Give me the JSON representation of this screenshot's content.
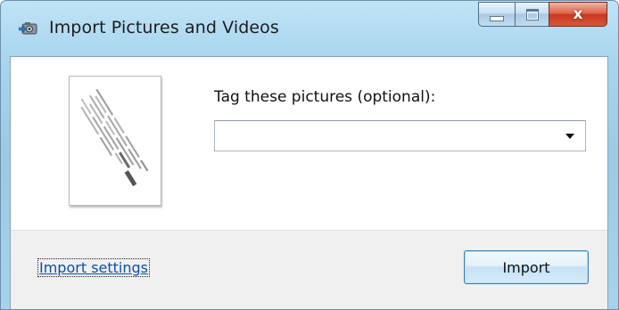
{
  "window": {
    "title": "Import Pictures and Videos",
    "app_icon": "camera-import-icon",
    "caption_buttons": {
      "minimize_icon": "minimize-icon",
      "maximize_icon": "maximize-icon",
      "close_icon": "close-icon",
      "close_glyph": "x"
    }
  },
  "thumbnail": {
    "icon": "scanned-document-thumbnail"
  },
  "tag": {
    "label": "Tag these pictures (optional):",
    "value": "",
    "placeholder": "",
    "dropdown_icon": "chevron-down-icon"
  },
  "footer": {
    "settings_link": "Import settings",
    "import_button": "Import"
  },
  "colors": {
    "titlebar": "#a9d6ee",
    "close_button": "#c8391f",
    "link": "#0d4fa8",
    "footer_bg": "#f0f0f0"
  }
}
